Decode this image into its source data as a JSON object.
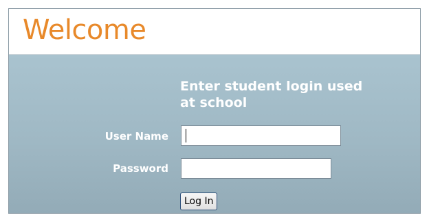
{
  "header": {
    "title": "Welcome"
  },
  "login_form": {
    "instructions": "Enter student login used at school",
    "username_label": "User Name",
    "username_value": "",
    "password_label": "Password",
    "password_value": "",
    "login_button_label": "Log In"
  },
  "colors": {
    "title_orange": "#e8892a",
    "panel_blue_gray": "#a9c3cf",
    "label_white": "#ffffff"
  }
}
